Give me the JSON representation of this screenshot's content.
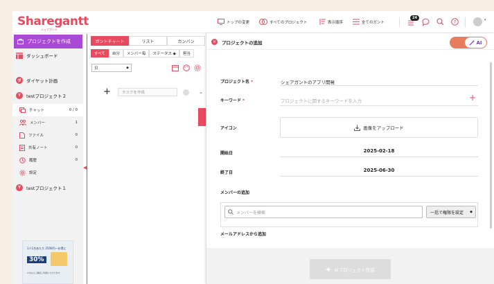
{
  "app": {
    "logo_text": "Sharegantt",
    "logo_sub": "シェアガント"
  },
  "topnav": {
    "items": [
      {
        "label": "トップの変更",
        "icon": "monitor-icon"
      },
      {
        "label": "すべてのプロジェクト",
        "icon": "projects-icon"
      },
      {
        "label": "表示順序",
        "icon": "sort-icon"
      },
      {
        "label": "全てのガント",
        "icon": "gantt-list-icon"
      }
    ],
    "notification_count": "24"
  },
  "sidebar": {
    "create_label": "プロジェクトを作成",
    "dashboard_label": "ダッシュボード",
    "projects": [
      {
        "initial": "ダ",
        "label": "ダイヤット計画"
      },
      {
        "initial": "T",
        "label": "testプロジェクト２"
      },
      {
        "initial": "T",
        "label": "testプロジェクト１"
      }
    ],
    "subitems": [
      {
        "label": "チャット",
        "count": "0 / 0",
        "icon": "chat-icon"
      },
      {
        "label": "メンバー",
        "count": "1",
        "icon": "members-icon"
      },
      {
        "label": "ファイル",
        "count": "0",
        "icon": "file-icon"
      },
      {
        "label": "共有ノート",
        "count": "0",
        "icon": "note-icon"
      },
      {
        "label": "履歴",
        "count": "0",
        "icon": "history-icon"
      },
      {
        "label": "設定",
        "count": "",
        "icon": "settings-icon"
      }
    ],
    "ad": {
      "line1": "1人1台あたり 2500円〜お得に",
      "percent": "30%",
      "line2": "※今ならご継続ご利用いただけます"
    }
  },
  "gantt": {
    "tabs": [
      "ガントチャート",
      "リスト",
      "カンバン"
    ],
    "filters": [
      "すべて",
      "自分",
      "メンバー毎",
      "ステータス ◆",
      "担当"
    ],
    "day_select": "日",
    "task_placeholder": "タスクを作成"
  },
  "modal": {
    "title": "プロジェクトの追加",
    "ai_label": "AI",
    "project_name_label": "プロジェクト名",
    "project_name_value": "シェアガントのアプリ開発",
    "keyword_label": "キーワード",
    "keyword_placeholder": "プロジェクトに関するキーワードを入力",
    "icon_label": "アイコン",
    "upload_label": "画像をアップロード",
    "start_label": "開始日",
    "start_value": "2025-02-18",
    "end_label": "終了日",
    "end_value": "2025-06-30",
    "members_label": "メンバーの追加",
    "member_search_placeholder": "メンバーを検索",
    "perm_label": "一括で権限を設定",
    "email_label": "メールアドレスから追加",
    "ai_create_label": "AIプロジェクト作成"
  },
  "colors": {
    "brand": "#e84a5f",
    "create_button": "#a84ad6",
    "ai_toggle": "#e87c5f"
  }
}
